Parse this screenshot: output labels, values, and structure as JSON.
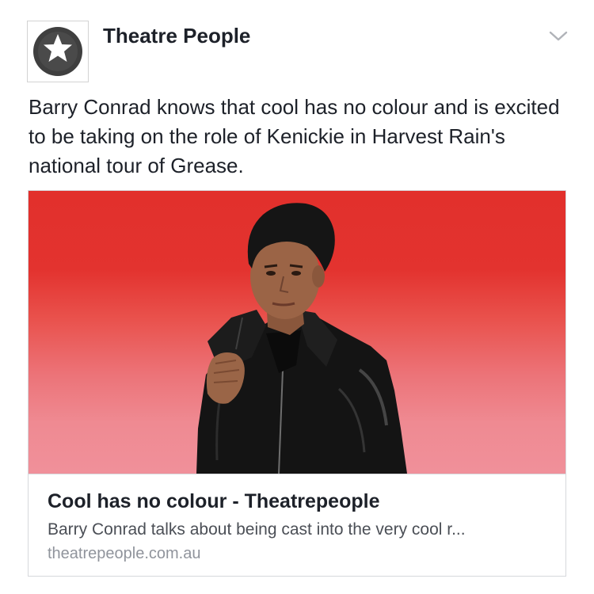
{
  "post": {
    "page_name": "Theatre People",
    "text": "Barry Conrad knows that cool has no colour and is excited to be taking on the role of Kenickie in Harvest Rain's national tour of Grease.",
    "avatar_icon": "star-in-circle-icon",
    "menu_icon": "chevron-down-icon"
  },
  "link": {
    "title": "Cool has no colour - Theatrepeople",
    "description": "Barry Conrad talks about being cast into the very cool r...",
    "domain": "theatrepeople.com.au",
    "image_icon": "portrait-photo"
  },
  "colors": {
    "image_top": "#e2302c",
    "image_bottom": "#f0909a",
    "avatar_circle": "#3f3f3f",
    "text": "#1d2129",
    "secondary_text": "#4b4f56",
    "domain_text": "#90949c"
  }
}
